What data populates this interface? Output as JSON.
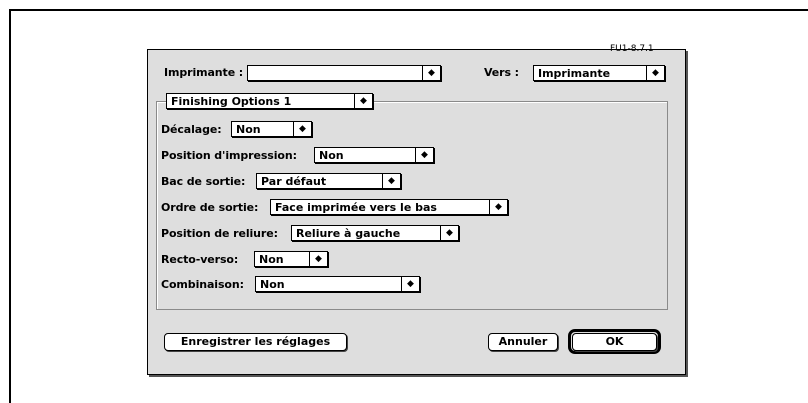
{
  "version": "FU1-8.7.1",
  "printer": {
    "label": "Imprimante :",
    "value": ""
  },
  "destination": {
    "label": "Vers :",
    "value": "Imprimante"
  },
  "panel": {
    "value": "Finishing Options 1"
  },
  "arrow": "◆",
  "fields": [
    {
      "label": "Décalage:",
      "value": "Non"
    },
    {
      "label": "Position d'impression:",
      "value": "Non"
    },
    {
      "label": "Bac de sortie:",
      "value": "Par défaut"
    },
    {
      "label": "Ordre de sortie:",
      "value": "Face imprimée vers le bas"
    },
    {
      "label": "Position de reliure:",
      "value": "Reliure à gauche"
    },
    {
      "label": "Recto-verso:",
      "value": "Non"
    },
    {
      "label": "Combinaison:",
      "value": "Non"
    }
  ],
  "buttons": {
    "save": "Enregistrer les réglages",
    "cancel": "Annuler",
    "ok": "OK"
  }
}
